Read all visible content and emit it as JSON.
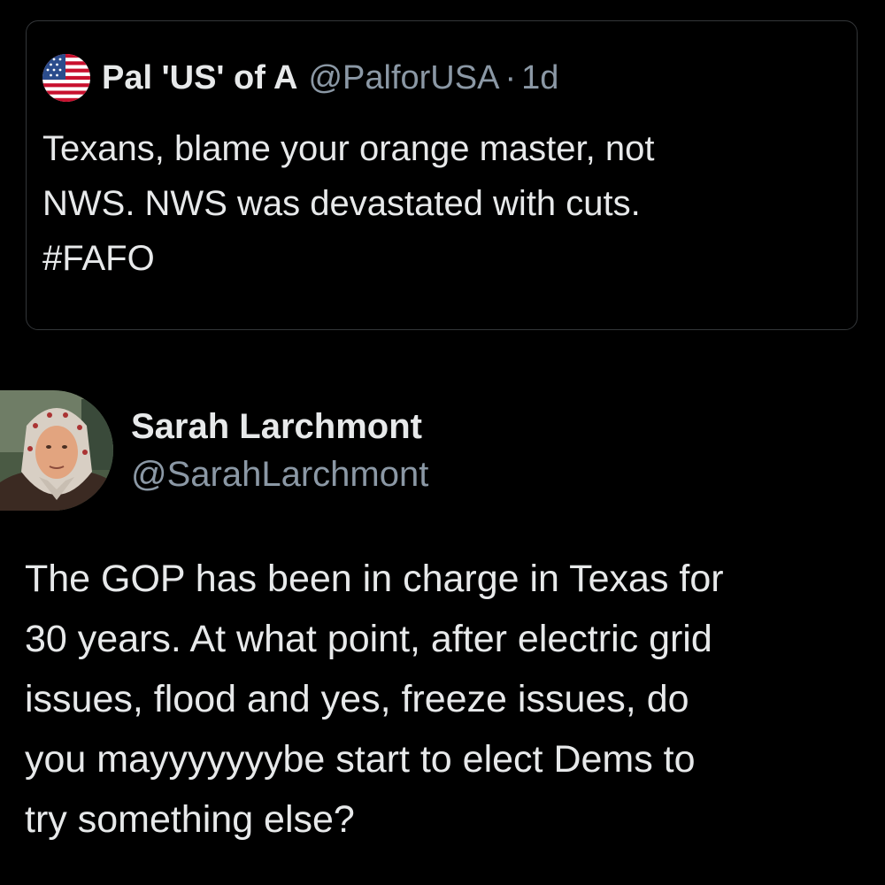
{
  "quoted_tweet": {
    "avatar_icon": "us-flag-icon",
    "display_name": "Pal 'US' of A",
    "handle": "@PalforUSA",
    "separator": "·",
    "time": "1d",
    "text": "Texans, blame your orange master, not\nNWS. NWS was devastated with cuts.\n#FAFO"
  },
  "tweet": {
    "avatar_icon": "profile-avatar",
    "display_name": "Sarah Larchmont",
    "handle": "@SarahLarchmont",
    "text": "The GOP has been in charge in Texas for\n30 years. At what point, after electric grid\nissues, flood and yes, freeze issues, do\nyou mayyyyyyybe start to elect Dems to\ntry something else?"
  },
  "colors": {
    "background": "#000000",
    "primary_text": "#e7e9ea",
    "secondary_text": "#8b98a5",
    "card_border": "#333639"
  }
}
